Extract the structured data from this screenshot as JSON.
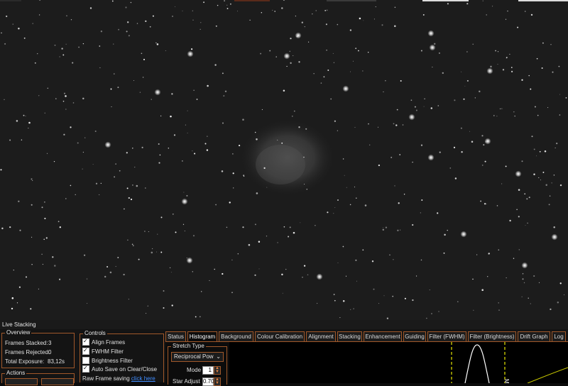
{
  "live_stacking": {
    "title": "Live Stacking",
    "overview": {
      "title": "Overview",
      "frames_stacked_label": "Frames Stacked:",
      "frames_stacked_value": "3",
      "frames_rejected_label": "Frames Rejected:",
      "frames_rejected_value": "0",
      "total_exposure_label": "Total Exposure:",
      "total_exposure_value": "83,12s"
    },
    "actions": {
      "title": "Actions"
    },
    "controls": {
      "title": "Controls",
      "align_frames": {
        "label": "Align Frames",
        "checked": true
      },
      "fwhm_filter": {
        "label": "FWHM Filter",
        "checked": true
      },
      "brightness_filter": {
        "label": "Brightness Filter",
        "checked": false
      },
      "auto_save": {
        "label": "Auto Save on Clear/Close",
        "checked": true
      },
      "raw_frame_saving_label": "Raw Frame saving",
      "raw_frame_saving_link": "click here"
    },
    "tabs": [
      "Status",
      "Histogram",
      "Background",
      "Colour Calibration",
      "Alignment",
      "Stacking",
      "Enhancement",
      "Guiding",
      "Filter (FWHM)",
      "Filter (Brightness)",
      "Drift Graph",
      "Log"
    ],
    "active_tab": "Histogram",
    "histogram": {
      "stretch_type_title": "Stretch Type",
      "stretch_type_value": "Reciprocal Pow",
      "mode_label": "Mode",
      "mode_value": "1",
      "star_adjust_label": "Star Adjust",
      "star_adjust_value": "0.70",
      "marker_label": "Mi"
    }
  },
  "colors": {
    "accent_border": "#a0582a",
    "link": "#3f8cff",
    "histogram_marker": "#e6e600",
    "panel_bg": "#141414"
  }
}
